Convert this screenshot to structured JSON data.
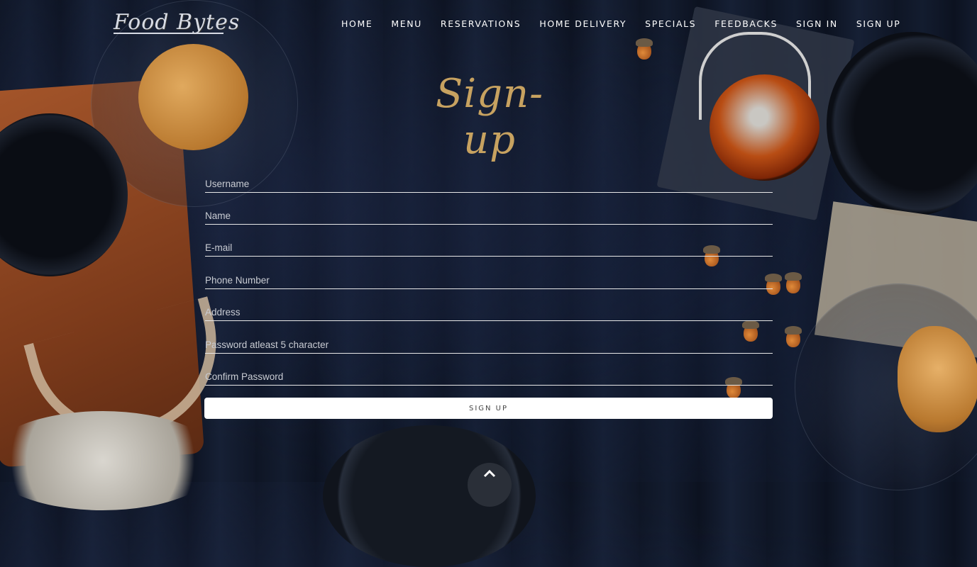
{
  "brand": {
    "logo_text": "Food Bytes"
  },
  "nav": {
    "items": [
      "HOME",
      "MENU",
      "RESERVATIONS",
      "HOME DELIVERY",
      "SPECIALS",
      "FEEDBACKS",
      "SIGN IN",
      "SIGN UP"
    ]
  },
  "form": {
    "title": "Sign-up",
    "fields": [
      {
        "name": "username",
        "placeholder": "Username"
      },
      {
        "name": "name",
        "placeholder": "Name"
      },
      {
        "name": "email",
        "placeholder": "E-mail"
      },
      {
        "name": "phone",
        "placeholder": "Phone Number"
      },
      {
        "name": "address",
        "placeholder": "Address"
      },
      {
        "name": "password",
        "placeholder": "Password atleast 5 character"
      },
      {
        "name": "confirm_password",
        "placeholder": "Confirm Password"
      }
    ],
    "submit_label": "SIGN UP"
  },
  "scroll_top": {
    "icon": "chevron-up-icon"
  },
  "colors": {
    "background": "#111a2c",
    "title_gold": "#c7a260",
    "underline": "#e8e8e8",
    "button_bg": "#ffffff"
  }
}
